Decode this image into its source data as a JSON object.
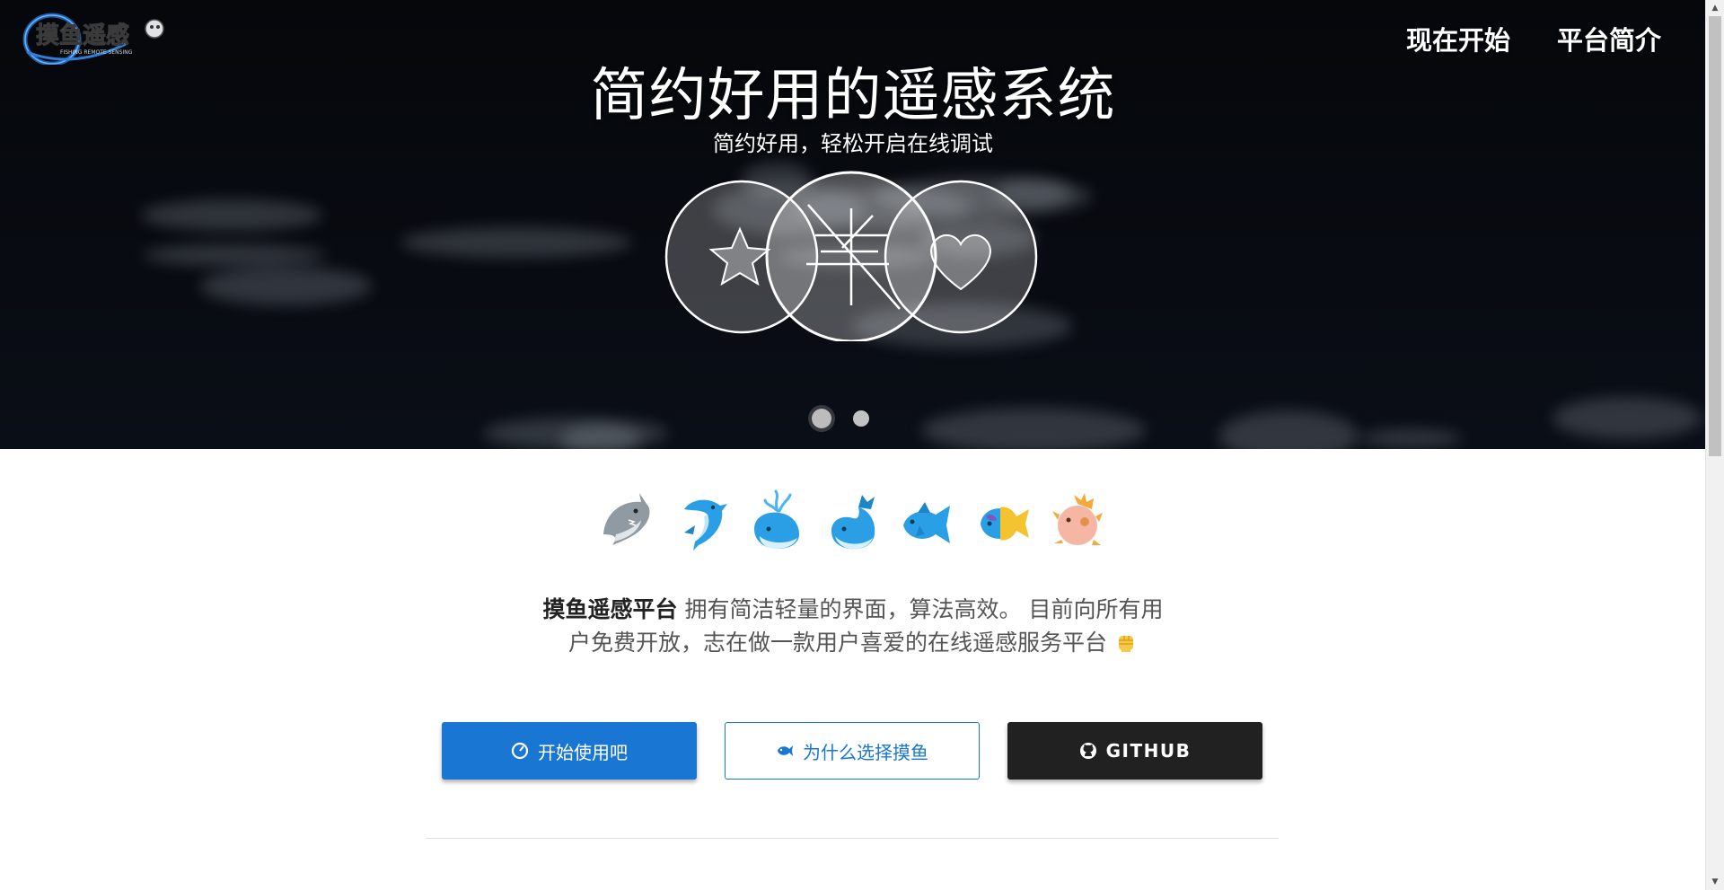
{
  "nav": {
    "start_now": "现在开始",
    "platform_intro": "平台简介"
  },
  "logo": {
    "text": "摸鱼遥感",
    "subtext": "FISHING REMOTE SENSING"
  },
  "hero": {
    "title": "简约好用的遥感系统",
    "subtitle": "简约好用，轻松开启在线调试",
    "carousel_icons": [
      "star-icon",
      "cross-lines-icon",
      "heart-icon"
    ],
    "carousel_active_index": 0,
    "carousel_count": 2
  },
  "fish_icons": [
    "shark-icon",
    "dolphin-icon",
    "spouting-whale-icon",
    "whale-icon",
    "fish-icon",
    "tropical-fish-icon",
    "blowfish-icon"
  ],
  "description": {
    "brand": "摸鱼遥感平台",
    "text": " 拥有简洁轻量的界面，算法高效。 目前向所有用户免费开放，志在做一款用户喜爱的在线遥感服务平台",
    "emoji": "raised-fist-icon"
  },
  "buttons": {
    "start": "开始使用吧",
    "why": "为什么选择摸鱼",
    "github": "GITHUB"
  },
  "colors": {
    "primary": "#1976d2",
    "dark": "#212121"
  }
}
